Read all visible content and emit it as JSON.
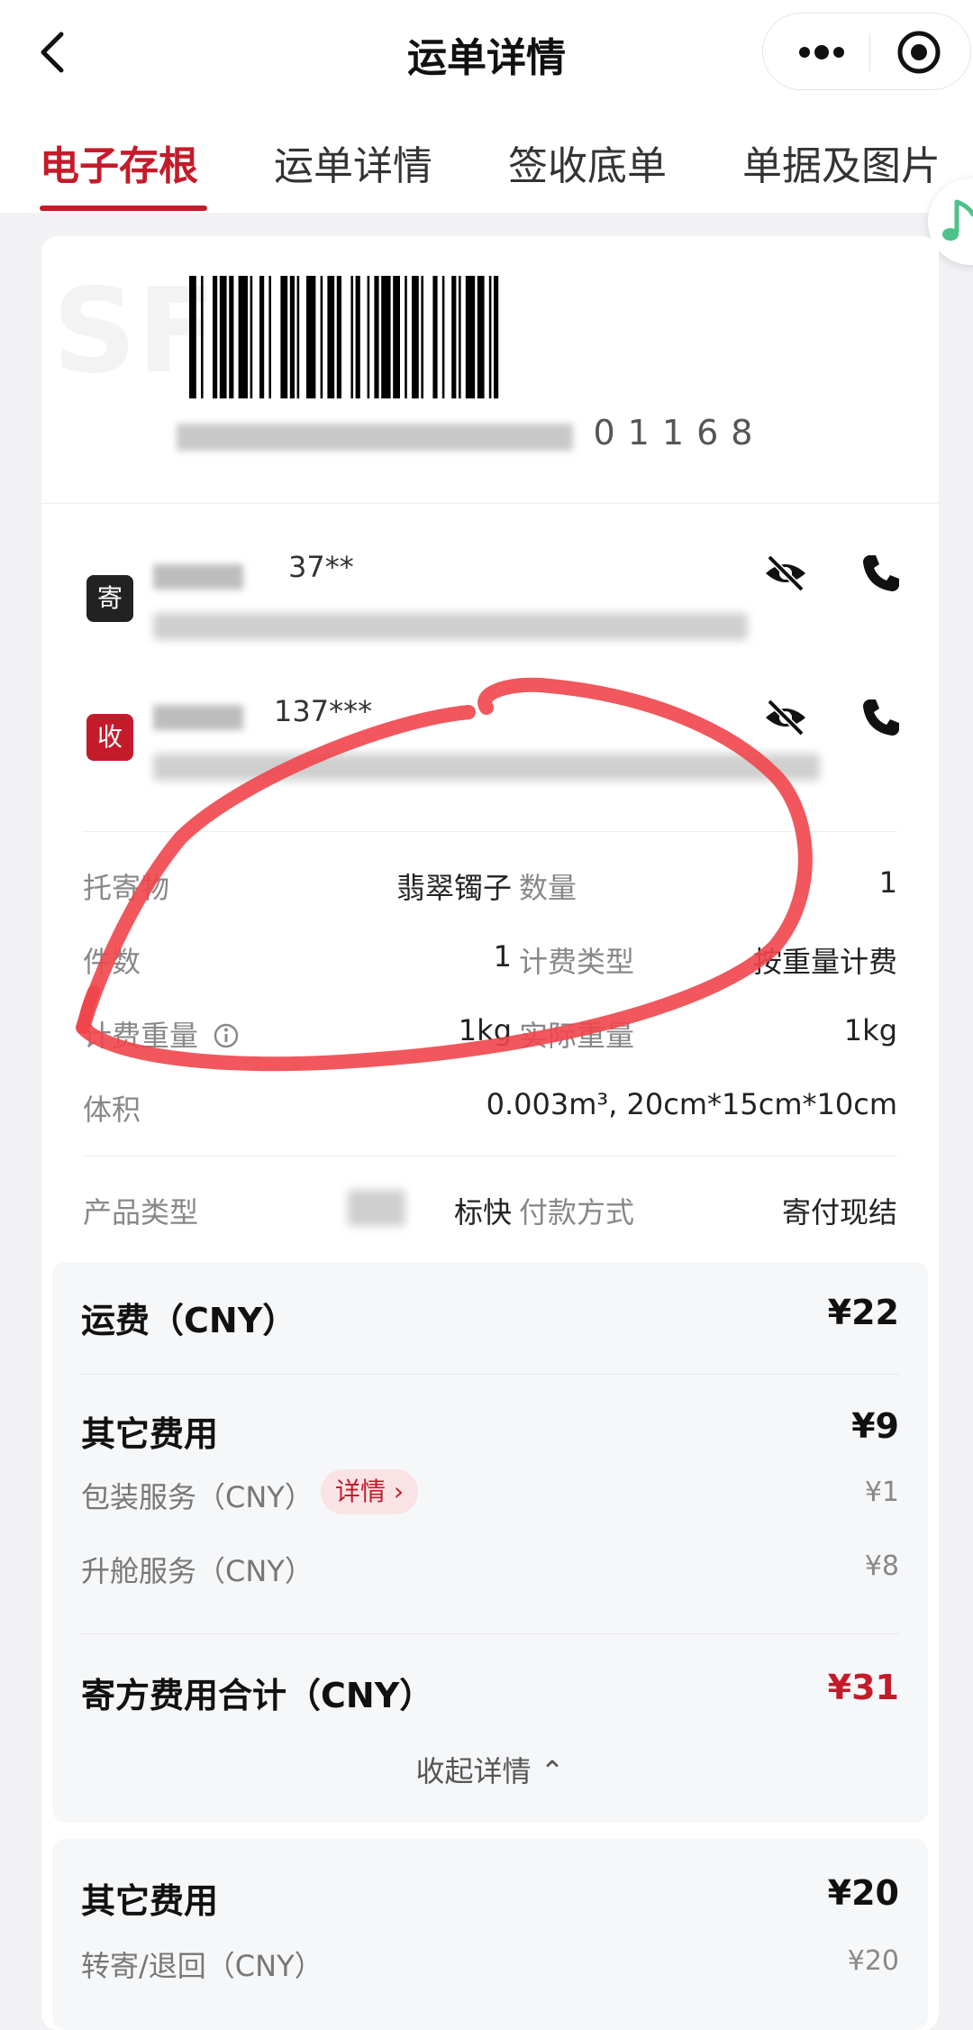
{
  "header": {
    "title": "运单详情"
  },
  "tabs": [
    {
      "label": "电子存根",
      "active": true
    },
    {
      "label": "运单详情",
      "active": false
    },
    {
      "label": "签收底单",
      "active": false
    },
    {
      "label": "单据及图片",
      "active": false
    }
  ],
  "waybill": {
    "number_visible_suffix": "01168"
  },
  "sender": {
    "tag": "寄",
    "phone_masked": "37**",
    "tag_color": "#222222"
  },
  "receiver": {
    "tag": "收",
    "phone_masked": "137***",
    "tag_color": "#c41b2a"
  },
  "shipment_info": {
    "item_label": "托寄物",
    "item_value": "翡翠镯子",
    "quantity_label": "数量",
    "quantity_value": "1",
    "pieces_label": "件数",
    "pieces_value": "1",
    "billing_type_label": "计费类型",
    "billing_type_value": "按重量计费",
    "billing_weight_label": "计费重量",
    "billing_weight_value": "1kg",
    "actual_weight_label": "实际重量",
    "actual_weight_value": "1kg",
    "volume_label": "体积",
    "volume_value": "0.003m³, 20cm*15cm*10cm",
    "product_type_label": "产品类型",
    "product_type_value": "标快",
    "payment_label": "付款方式",
    "payment_value": "寄付现结"
  },
  "fees": {
    "freight_title": "运费（CNY）",
    "freight_amount": "¥22",
    "other_title": "其它费用",
    "other_amount": "¥9",
    "packaging_label": "包装服务（CNY）",
    "packaging_detail": "详情 ›",
    "packaging_amount": "¥1",
    "lift_label": "升舱服务（CNY）",
    "lift_amount": "¥8",
    "sender_total_title": "寄方费用合计（CNY）",
    "sender_total_amount": "¥31",
    "collapse_label": "收起详情 ⌃",
    "other2_title": "其它费用",
    "other2_amount": "¥20",
    "forward_label": "转寄/退回（CNY）",
    "forward_amount": "¥20"
  },
  "colors": {
    "brand_red": "#c41b2a",
    "annotation_red": "#f0454a"
  },
  "icons": [
    "back-arrow-icon",
    "more-dots-icon",
    "target-icon",
    "music-note-icon",
    "eye-hidden-icon",
    "phone-icon",
    "info-icon"
  ]
}
